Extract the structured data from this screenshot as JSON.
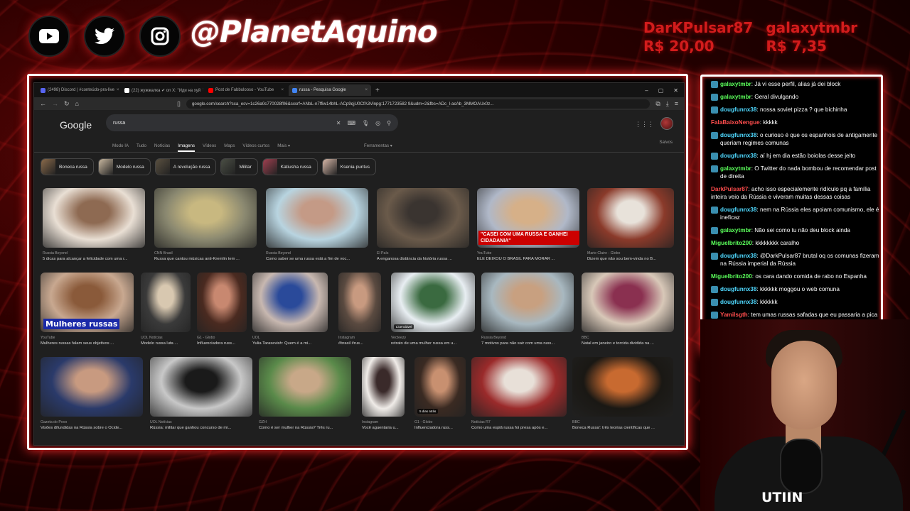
{
  "colors": {
    "accent": "#ff2a2a",
    "donor": "#d21c1c",
    "chat_user_green": "#5bff5b",
    "chat_user_cyan": "#4fd9ff",
    "chat_user_red": "#ff4d4d"
  },
  "socials": [
    {
      "name": "youtube-icon"
    },
    {
      "name": "twitter-icon"
    },
    {
      "name": "instagram-icon"
    }
  ],
  "handle": "@PlanetAquino",
  "donors": [
    {
      "name": "DarKPulsar87",
      "amount": "R$ 20,00"
    },
    {
      "name": "galaxytmbr",
      "amount": "R$ 7,35"
    }
  ],
  "browser": {
    "tabs": [
      {
        "label": "(2498) Discord | #conteúdo-pra-live",
        "fav": "#5865f2"
      },
      {
        "label": "(22) жужжалка ✔ on X: \"Иди на хуй",
        "fav": "#fff"
      },
      {
        "label": "Post de Fabbulooso - YouTube",
        "fav": "#ff0000"
      },
      {
        "label": "russa - Pesquisa Google",
        "fav": "#4285f4",
        "active": true
      }
    ],
    "url": "google.com/search?sca_esv=1c26a0c770028f06&sxsrf=ANbL-n7ffiw14bhL-ACp9qjU0CfA3Vinpg:1771723582 9&udm=2&fbs=ADc_l-acAb_3MMOAUx0z..."
  },
  "google": {
    "logo": "Google",
    "query": "russa",
    "nav": [
      "Modo IA",
      "Tudo",
      "Notícias",
      "Imagens",
      "Vídeos",
      "Maps",
      "Vídeos curtos",
      "Mais ▾"
    ],
    "tools": "Ferramentas ▾",
    "saved": "Salvos",
    "chips": [
      {
        "label": "Boneca russa",
        "c": "#8a6a4a"
      },
      {
        "label": "Modelo russa",
        "c": "#c9b8a0"
      },
      {
        "label": "A revolução russa",
        "c": "#5a5040"
      },
      {
        "label": "Militar",
        "c": "#4a4e44"
      },
      {
        "label": "Katiusha russa",
        "c": "#a04050"
      },
      {
        "label": "Ksenia puntus",
        "c": "#d8b8a8"
      }
    ]
  },
  "results": {
    "row1": [
      {
        "src": "Russia Beyond",
        "cap": "5 dicas para alcançar a felicidade com uma r...",
        "c1": "#e9dfd4",
        "c2": "#8e6a52"
      },
      {
        "src": "CNN Brasil",
        "cap": "Russa que cantou músicas anti-Kremlin tem ...",
        "c1": "#8a8870",
        "c2": "#c8b880"
      },
      {
        "src": "Russia Beyond",
        "cap": "Como saber se uma russa está a fim de voc...",
        "c1": "#b8d4e0",
        "c2": "#c49a86"
      },
      {
        "src": "El País",
        "cap": "A enganosa distância da história russa ...",
        "c1": "#6a5a4a",
        "c2": "#3a3430"
      },
      {
        "src": "YouTube",
        "cap": "ELE DEIXOU O BRASIL PARA MORAR ...",
        "c1": "#b0b8c8",
        "c2": "#d6b088",
        "ovl": "\"CASEI COM UMA RUSSA E GANHEI CIDADANIA\""
      },
      {
        "src": "Marie Claire - Globo",
        "cap": "Dizem que não sou bem-vinda no B...",
        "c1": "#8a3a2a",
        "c2": "#e8e2da"
      }
    ],
    "row2": [
      {
        "src": "YouTube",
        "cap": "Mulheres russas falam seus objetivos ...",
        "c1": "#c8a890",
        "c2": "#8a5a3a",
        "ovl": "Mulheres russas"
      },
      {
        "src": "UOL Notícias",
        "cap": "Modelo russa luta ...",
        "c1": "#3a3a3a",
        "c2": "#d8c8b0"
      },
      {
        "src": "G1 - Globo",
        "cap": "Influenciadora russ...",
        "c1": "#4a2a20",
        "c2": "#c88870"
      },
      {
        "src": "UOL",
        "cap": "Yulia Tarasevish: Quem é a mi...",
        "c1": "#c8b8b0",
        "c2": "#2a4a9a"
      },
      {
        "src": "Instagram",
        "cap": "#brasil #rus...",
        "c1": "#5a4a40",
        "c2": "#c89a80"
      },
      {
        "src": "Vecteezy",
        "cap": "retrato de uma mulher russa em u...",
        "c1": "#e8eef2",
        "c2": "#3a6a40",
        "badge": "Licenciável"
      },
      {
        "src": "Russia Beyond",
        "cap": "7 motivos para não sair com uma russ...",
        "c1": "#a8b8c0",
        "c2": "#c8a080"
      },
      {
        "src": "BBC",
        "cap": "Natal em janeiro e torcida dividida na ...",
        "c1": "#d8c8b8",
        "c2": "#8a3050"
      }
    ],
    "row3": [
      {
        "src": "Gazeta do Povo",
        "cap": "Visões difundidas na Rússia sobre o Ocide...",
        "c1": "#2a3a6a",
        "c2": "#c89a80"
      },
      {
        "src": "UOL Notícias",
        "cap": "Rússia: militar que ganhou concurso de mi...",
        "c1": "#c8c8c8",
        "c2": "#1a1a1a"
      },
      {
        "src": "GZH",
        "cap": "Como é ser mulher na Rússia? Três ru...",
        "c1": "#5a8a4a",
        "c2": "#c8a888"
      },
      {
        "src": "Instagram",
        "cap": "Você aguentaria u...",
        "c1": "#f0ece8",
        "c2": "#3a2a2a"
      },
      {
        "src": "G1 - Globo",
        "cap": "Influenciadora russ...",
        "c1": "#3a2a22",
        "c2": "#c89070",
        "badge": "5 dias atrás"
      },
      {
        "src": "Notícias R7",
        "cap": "Como uma espiã russa foi presa após e...",
        "c1": "#9a2a2a",
        "c2": "#e8e0d8"
      },
      {
        "src": "BBC",
        "cap": "Boneca Russa': três teorias científicas que ...",
        "c1": "#1a1814",
        "c2": "#c86a30"
      }
    ]
  },
  "chat": [
    {
      "u": "galaxytmbr",
      "t": "Já vi esse perfil, alias já dei block",
      "c": "#5bff5b",
      "b": true
    },
    {
      "u": "galaxytmbr",
      "t": "Geral divulgando",
      "c": "#5bff5b",
      "b": true
    },
    {
      "u": "dougfunnx38",
      "t": "nossa soviet pizza ? que bichinha",
      "c": "#4fd9ff",
      "b": true
    },
    {
      "u": "FalaBaixoNengue",
      "t": "kkkkk",
      "c": "#ff4d4d",
      "b": false
    },
    {
      "u": "dougfunnx38",
      "t": "o curioso é que os espanhois de antigamente queriam regimes comunas",
      "c": "#4fd9ff",
      "b": true
    },
    {
      "u": "dougfunnx38",
      "t": "aí hj em dia estão boiolas desse jeito",
      "c": "#4fd9ff",
      "b": true
    },
    {
      "u": "galaxytmbr",
      "t": "O Twitter do nada bombou de recomendar post de direita",
      "c": "#5bff5b",
      "b": true
    },
    {
      "u": "DarkPulsar87",
      "t": "acho isso especialemente ridículo pq a família inteira veio da Rússia e viveram muitas dessas coisas",
      "c": "#ff4d4d",
      "b": false
    },
    {
      "u": "dougfunnx38",
      "t": "nem na Rússia eles apoiam comunismo, ele é ineficaz",
      "c": "#4fd9ff",
      "b": true
    },
    {
      "u": "galaxytmbr",
      "t": "Não sei como tu não deu block ainda",
      "c": "#5bff5b",
      "b": true
    },
    {
      "u": "Miguelbrito200",
      "t": "kkkkkkkk caralho",
      "c": "#5bff5b",
      "b": false
    },
    {
      "u": "dougfunnx38",
      "t": "@DarkPulsar87 brutal oq os comunas fizeram na Rússia imperial da Rússia",
      "c": "#4fd9ff",
      "b": true
    },
    {
      "u": "Miguelbrito200",
      "t": "os cara dando comida de rabo no Espanha",
      "c": "#5bff5b",
      "b": false
    },
    {
      "u": "dougfunnx38",
      "t": "kkkkkk moggou o web comuna",
      "c": "#4fd9ff",
      "b": true
    },
    {
      "u": "dougfunnx38",
      "t": "kkkkkk",
      "c": "#4fd9ff",
      "b": true
    },
    {
      "u": "Yamilsgth",
      "t": "tem umas russas safadas que eu passaria a pica",
      "c": "#ff4d4d",
      "b": true
    },
    {
      "u": "Miguelbrito200",
      "t": "",
      "c": "#5bff5b",
      "b": false
    }
  ],
  "webcam": {
    "shirt_text": "UTIIN"
  }
}
